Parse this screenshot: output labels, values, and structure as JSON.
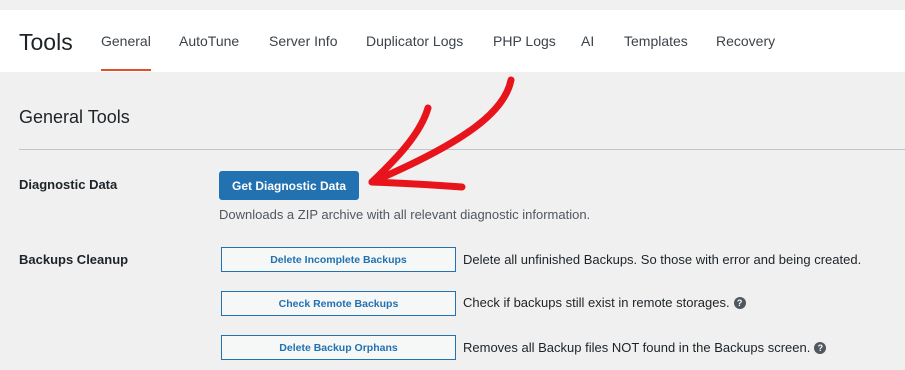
{
  "header": {
    "title": "Tools",
    "tabs": [
      {
        "label": "General",
        "active": true
      },
      {
        "label": "AutoTune"
      },
      {
        "label": "Server Info"
      },
      {
        "label": "Duplicator Logs"
      },
      {
        "label": "PHP Logs"
      },
      {
        "label": "AI"
      },
      {
        "label": "Templates"
      },
      {
        "label": "Recovery"
      }
    ]
  },
  "section": {
    "title": "General Tools"
  },
  "diagnostic": {
    "label": "Diagnostic Data",
    "button": "Get Diagnostic Data",
    "description": "Downloads a ZIP archive with all relevant diagnostic information."
  },
  "cleanup": {
    "label": "Backups Cleanup",
    "actions": [
      {
        "button": "Delete Incomplete Backups",
        "description": "Delete all unfinished Backups. So those with error and being created."
      },
      {
        "button": "Check Remote Backups",
        "description": "Check if backups still exist in remote storages."
      },
      {
        "button": "Delete Backup Orphans",
        "description": "Removes all Backup files NOT found in the Backups screen."
      }
    ]
  },
  "icons": {
    "help": "?"
  },
  "colors": {
    "accent": "#e0502b",
    "primary_button": "#2271b1",
    "annotation_arrow": "#e8141c"
  }
}
